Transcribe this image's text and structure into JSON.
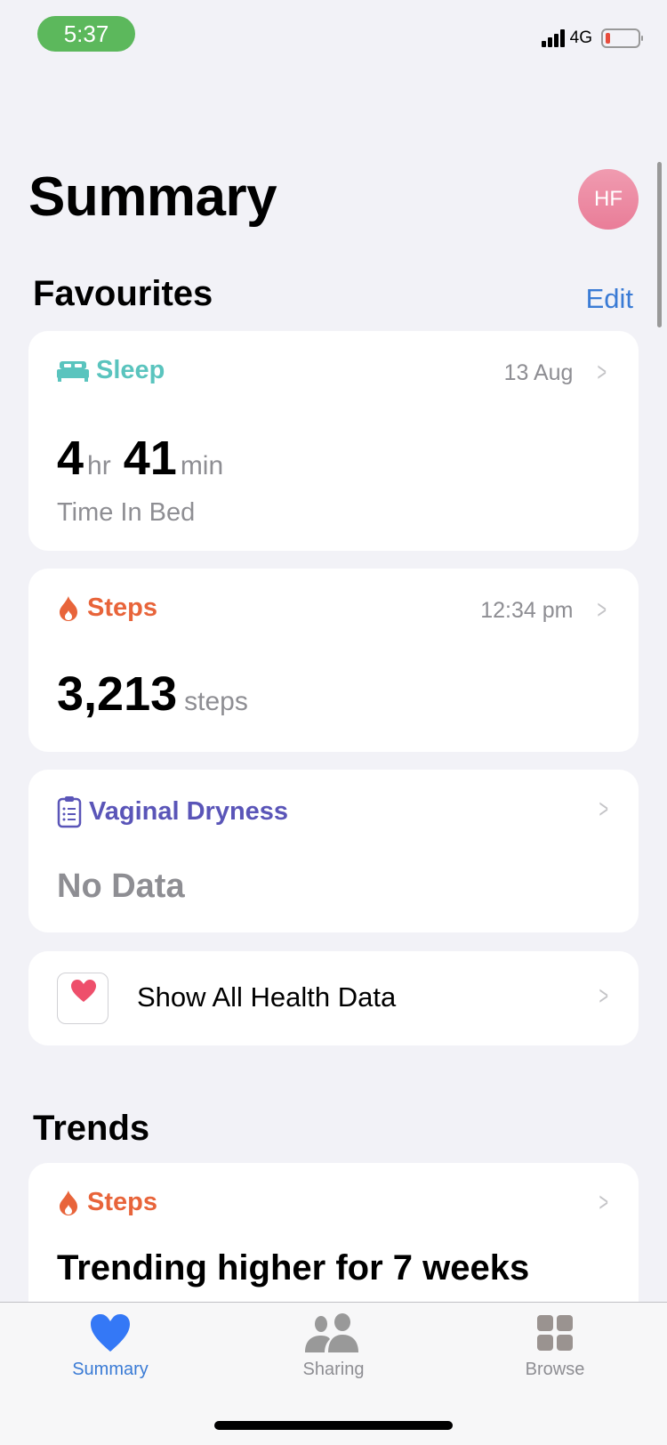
{
  "status_bar": {
    "time": "5:37",
    "network": "4G",
    "battery_level_percent": 10
  },
  "header": {
    "title": "Summary",
    "avatar_initials": "HF"
  },
  "favourites": {
    "title": "Favourites",
    "edit_label": "Edit",
    "cards": {
      "sleep": {
        "title": "Sleep",
        "meta": "13 Aug",
        "hours": "4",
        "hours_unit": "hr",
        "minutes": "41",
        "minutes_unit": "min",
        "sub_label": "Time In Bed",
        "color": "#5ac4be"
      },
      "steps": {
        "title": "Steps",
        "meta": "12:34 pm",
        "value": "3,213",
        "unit": "steps",
        "color": "#e8643a"
      },
      "vaginal_dryness": {
        "title": "Vaginal Dryness",
        "value": "No Data",
        "color": "#5a55b8"
      }
    },
    "show_all_label": "Show All Health Data"
  },
  "trends": {
    "title": "Trends",
    "card": {
      "title": "Steps",
      "text": "Trending higher for 7 weeks",
      "color": "#e8643a"
    }
  },
  "tab_bar": {
    "tabs": [
      {
        "label": "Summary",
        "icon": "heart-icon",
        "active": true
      },
      {
        "label": "Sharing",
        "icon": "people-icon",
        "active": false
      },
      {
        "label": "Browse",
        "icon": "grid-icon",
        "active": false
      }
    ],
    "active_color": "#3a7bd5",
    "inactive_color": "#8e8e93"
  }
}
